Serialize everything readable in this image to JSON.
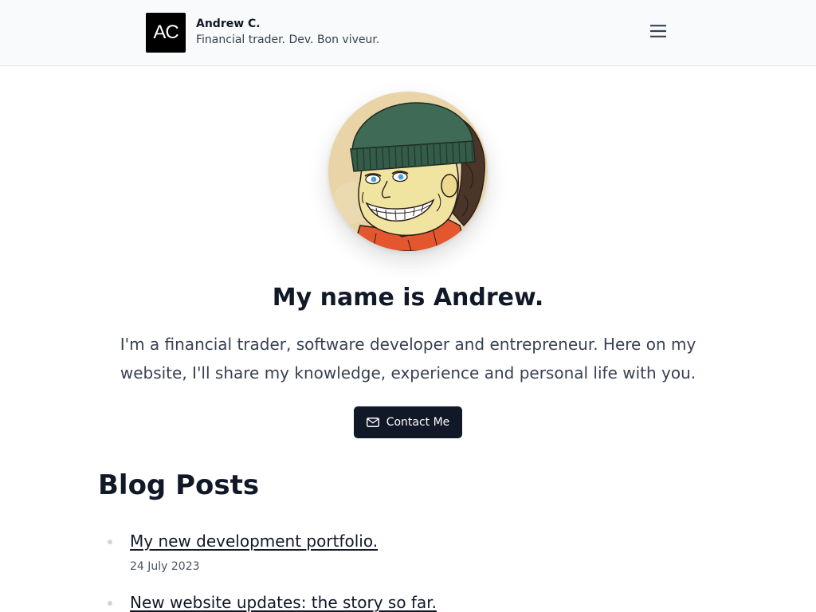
{
  "colors": {
    "header_bg": "#f9fafb",
    "header_border": "#e5e7eb",
    "logo_bg": "#000000",
    "text_primary": "#111827",
    "text_body": "#374151",
    "text_muted": "#4b5563",
    "button_bg": "#111827",
    "button_text": "#ffffff",
    "bullet": "#d1d5db"
  },
  "header": {
    "logo_text": "AC",
    "name": "Andrew C.",
    "tagline": "Financial trader. Dev. Bon viveur.",
    "menu_icon": "hamburger-menu-icon"
  },
  "hero": {
    "heading": "My name is Andrew.",
    "intro": "I'm a financial trader, software developer and entrepreneur. Here on my website, I'll share my knowledge, experience and personal life with you.",
    "contact_button": {
      "label": "Contact Me",
      "icon": "mail-icon"
    }
  },
  "blog": {
    "heading": "Blog Posts",
    "posts": [
      {
        "title": "My new development portfolio.",
        "date": "24 July 2023"
      },
      {
        "title": "New website updates: the story so far."
      }
    ]
  }
}
